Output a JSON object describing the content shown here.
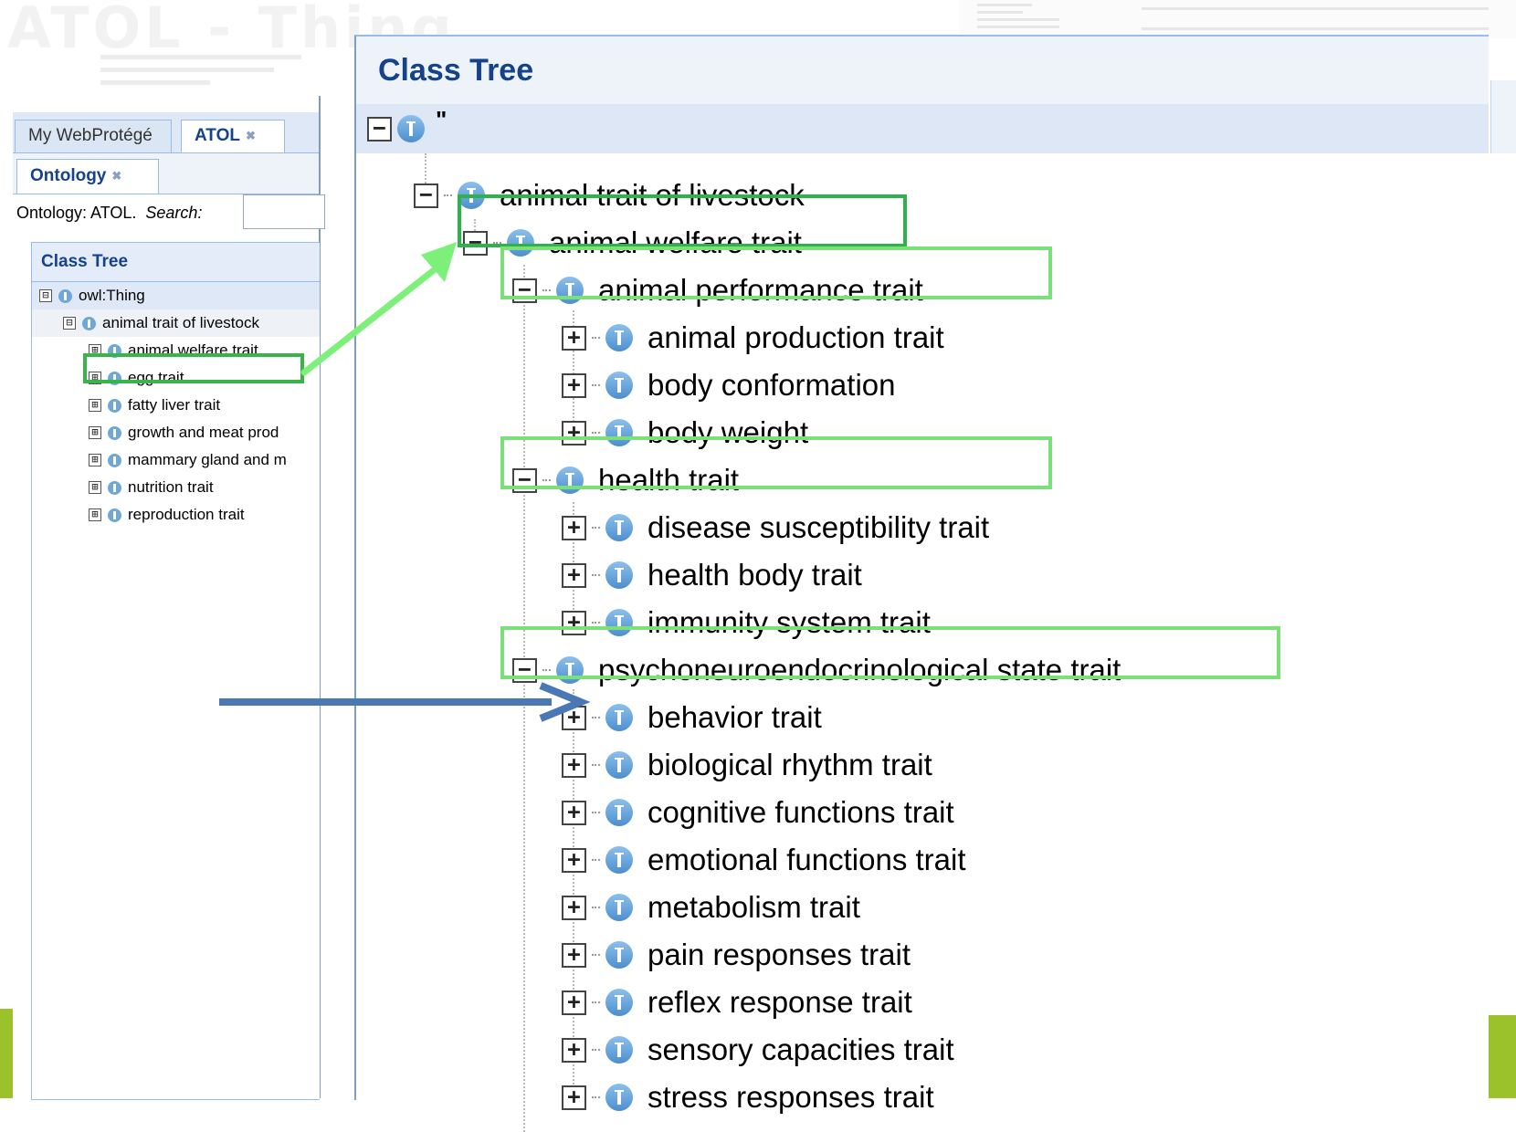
{
  "background": {
    "title_fragment": "ATOL - Thing"
  },
  "left_screenshot": {
    "tabs": [
      {
        "label": "My WebProtégé",
        "closable": false
      },
      {
        "label": "ATOL",
        "closable": true
      }
    ],
    "subtab": {
      "label": "Ontology",
      "closable": true
    },
    "ontology_label": "Ontology: ATOL.",
    "search_label": "Search:",
    "search_value": "",
    "tree": {
      "header": "Class Tree",
      "rows": [
        {
          "label": "owl:Thing",
          "toggle": "⊟"
        },
        {
          "label": "animal trait of livestock",
          "toggle": "⊟"
        },
        {
          "label": "animal welfare trait",
          "toggle": "⊞"
        },
        {
          "label": "egg trait",
          "toggle": "⊞"
        },
        {
          "label": "fatty liver trait",
          "toggle": "⊞"
        },
        {
          "label": "growth and meat prod",
          "toggle": "⊞"
        },
        {
          "label": "mammary gland and m",
          "toggle": "⊞"
        },
        {
          "label": "nutrition trait",
          "toggle": "⊞"
        },
        {
          "label": "reproduction trait",
          "toggle": "⊞"
        }
      ]
    }
  },
  "main_tree": {
    "header": "Class Tree",
    "root_label": "\"",
    "rows": [
      {
        "label": "animal trait of livestock",
        "toggle": "⊟"
      },
      {
        "label": "animal welfare trait",
        "toggle": "⊟"
      },
      {
        "label": "animal performance trait",
        "toggle": "⊟"
      },
      {
        "label": "animal production trait",
        "toggle": "⊞"
      },
      {
        "label": "body conformation",
        "toggle": "⊞"
      },
      {
        "label": "body weight",
        "toggle": "⊞"
      },
      {
        "label": "health trait",
        "toggle": "⊟"
      },
      {
        "label": "disease susceptibility trait",
        "toggle": "⊞"
      },
      {
        "label": "health body trait",
        "toggle": "⊞"
      },
      {
        "label": "immunity system trait",
        "toggle": "⊞"
      },
      {
        "label": "psychoneuroendocrinological state trait",
        "toggle": "⊟"
      },
      {
        "label": "behavior trait",
        "toggle": "⊞"
      },
      {
        "label": "biological rhythm trait",
        "toggle": "⊞"
      },
      {
        "label": "cognitive functions trait",
        "toggle": "⊞"
      },
      {
        "label": "emotional functions trait",
        "toggle": "⊞"
      },
      {
        "label": "metabolism trait",
        "toggle": "⊞"
      },
      {
        "label": "pain responses trait",
        "toggle": "⊞"
      },
      {
        "label": "reflex response trait",
        "toggle": "⊞"
      },
      {
        "label": "sensory capacities trait",
        "toggle": "⊞"
      },
      {
        "label": "stress responses trait",
        "toggle": "⊞"
      }
    ]
  },
  "colors": {
    "highlight_dark": "#2db34a",
    "highlight_light": "#7be07a",
    "arrow_green": "#7df07a",
    "arrow_blue": "#4a78b4",
    "header_text": "#15428b"
  },
  "icons": {
    "class_icon": "class-circle-icon",
    "expand": "plus-box-icon",
    "collapse": "minus-box-icon"
  }
}
